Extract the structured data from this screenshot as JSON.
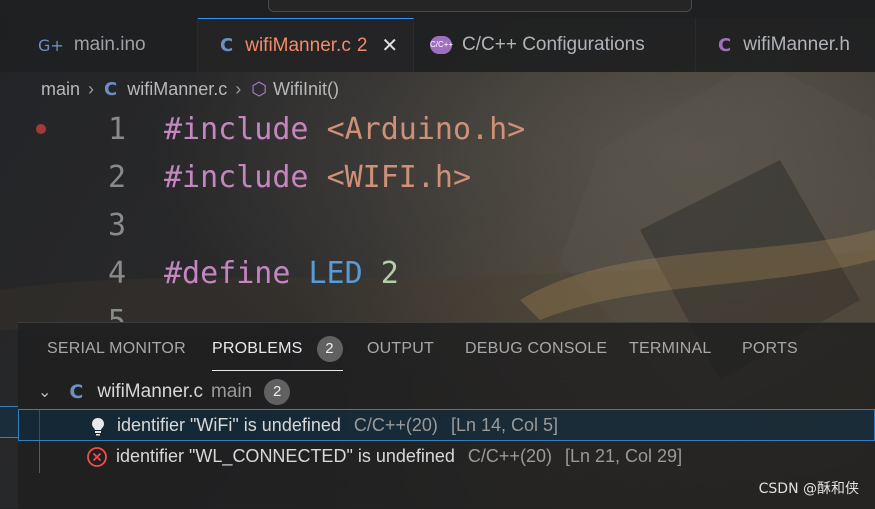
{
  "tabs": [
    {
      "icon": "arduino-file-icon",
      "label": "main.ino"
    },
    {
      "icon": "c-file-icon",
      "label": "wifiManner.c",
      "count": "2",
      "active": true
    },
    {
      "icon": "c-cpp-config-icon",
      "label": "C/C++ Configurations"
    },
    {
      "icon": "c-file-icon",
      "label": "wifiManner.h"
    }
  ],
  "breadcrumb": {
    "root": "main",
    "file": "wifiManner.c",
    "symbol": "WifiInit()"
  },
  "editor": {
    "lines": [
      {
        "num": "1",
        "directive": "#include",
        "arg": "<Arduino.h>"
      },
      {
        "num": "2",
        "directive": "#include",
        "arg": "<WIFI.h>"
      },
      {
        "num": "3"
      },
      {
        "num": "4",
        "directive": "#define",
        "name": "LED",
        "value": "2"
      },
      {
        "num": "5"
      }
    ]
  },
  "panel": {
    "tabs": [
      "SERIAL MONITOR",
      "PROBLEMS",
      "OUTPUT",
      "DEBUG CONSOLE",
      "TERMINAL",
      "PORTS"
    ],
    "active_tab": "PROBLEMS",
    "problems_count": "2",
    "file_group": {
      "file": "wifiManner.c",
      "dir": "main",
      "count": "2"
    },
    "problems": [
      {
        "severity": "info",
        "icon": "lightbulb-icon",
        "message": "identifier \"WiFi\" is undefined",
        "source": "C/C++(20)",
        "location": "[Ln 14, Col 5]"
      },
      {
        "severity": "error",
        "icon": "error-circle-icon",
        "message": "identifier \"WL_CONNECTED\" is undefined",
        "source": "C/C++(20)",
        "location": "[Ln 21, Col 29]"
      }
    ]
  },
  "watermark": "CSDN @酥和侠",
  "colors": {
    "accent": "#3794ff",
    "active_tab_text": "#f28b6c",
    "keyword": "#c586c0",
    "string": "#ce9178",
    "macro": "#569cd6",
    "number": "#b5cea8",
    "error": "#f14c4c"
  }
}
